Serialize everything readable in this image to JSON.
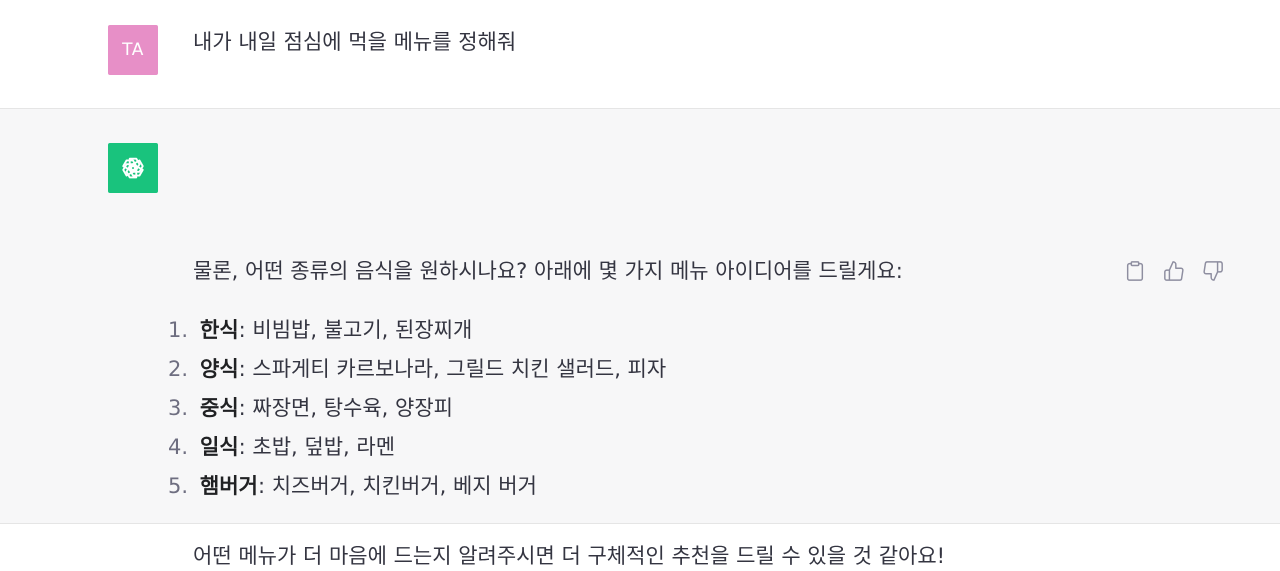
{
  "user_message": {
    "avatar_initials": "TA",
    "avatar_color": "#e78fc7",
    "text": "내가 내일 점심에 먹을 메뉴를 정해줘"
  },
  "assistant_message": {
    "avatar_icon": "openai-logo-icon",
    "avatar_color": "#19c37d",
    "intro": "물론, 어떤 종류의 음식을 원하시나요? 아래에 몇 가지 메뉴 아이디어를 드릴게요:",
    "items": [
      {
        "num": "1.",
        "term": "한식",
        "detail": ": 비빔밥, 불고기, 된장찌개"
      },
      {
        "num": "2.",
        "term": "양식",
        "detail": ": 스파게티 카르보나라, 그릴드 치킨 샐러드, 피자"
      },
      {
        "num": "3.",
        "term": "중식",
        "detail": ": 짜장면, 탕수육, 양장피"
      },
      {
        "num": "4.",
        "term": "일식",
        "detail": ": 초밥, 덮밥, 라멘"
      },
      {
        "num": "5.",
        "term": "햄버거",
        "detail": ": 치즈버거, 치킨버거, 베지 버거"
      }
    ],
    "closing": "어떤 메뉴가 더 마음에 드는지 알려주시면 더 구체적인 추천을 드릴 수 있을 것 같아요!",
    "actions": [
      "clipboard-icon",
      "thumbs-up-icon",
      "thumbs-down-icon"
    ]
  }
}
